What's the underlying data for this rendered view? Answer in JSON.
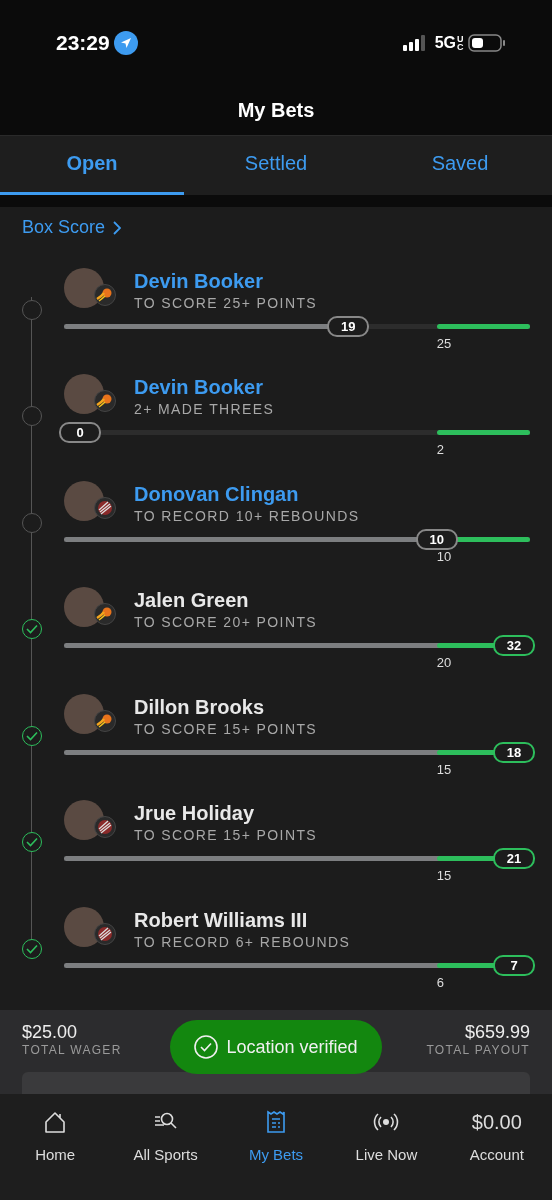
{
  "status_bar": {
    "time": "23:29",
    "network": "5G",
    "network_suffix": "UC"
  },
  "header": {
    "title": "My Bets"
  },
  "tabs": [
    {
      "label": "Open",
      "selected": true
    },
    {
      "label": "Settled",
      "selected": false
    },
    {
      "label": "Saved",
      "selected": false
    }
  ],
  "box_score_link": "Box Score",
  "legs": [
    {
      "player": "Devin Booker",
      "market": "TO SCORE 25+ POINTS",
      "kind": "sun",
      "hit": false,
      "current": "19",
      "target": "25",
      "level": 0.61
    },
    {
      "player": "Devin Booker",
      "market": "2+ MADE THREES",
      "kind": "sun",
      "hit": false,
      "current": "0",
      "target": "2",
      "level": 0
    },
    {
      "player": "Donovan Clingan",
      "market": "TO RECORD 10+ REBOUNDS",
      "kind": "pinwheel",
      "hit": false,
      "current": "10",
      "target": "10",
      "level": 0.8
    },
    {
      "player": "Jalen Green",
      "market": "TO SCORE 20+ POINTS",
      "kind": "sun",
      "hit": true,
      "current": "32",
      "target": "20",
      "level": 1
    },
    {
      "player": "Dillon Brooks",
      "market": "TO SCORE 15+ POINTS",
      "kind": "sun",
      "hit": true,
      "current": "18",
      "target": "15",
      "level": 1
    },
    {
      "player": "Jrue Holiday",
      "market": "TO SCORE 15+ POINTS",
      "kind": "pinwheel",
      "hit": true,
      "current": "21",
      "target": "15",
      "level": 1
    },
    {
      "player": "Robert Williams III",
      "market": "TO RECORD 6+ REBOUNDS",
      "kind": "pinwheel",
      "hit": true,
      "current": "7",
      "target": "6",
      "level": 1
    }
  ],
  "summary": {
    "wager": "$25.00",
    "wager_label": "TOTAL WAGER",
    "payout": "$659.99",
    "payout_label": "TOTAL PAYOUT"
  },
  "toast": {
    "text": "Location verified"
  },
  "nav": [
    {
      "kind": "home",
      "label": "Home",
      "selected": false
    },
    {
      "kind": "sports",
      "label": "All Sports",
      "selected": false
    },
    {
      "kind": "bets",
      "label": "My Bets",
      "selected": true
    },
    {
      "kind": "live",
      "label": "Live Now",
      "selected": false
    },
    {
      "kind": "balance",
      "value": "$0.00",
      "label": "Account",
      "selected": false
    }
  ]
}
